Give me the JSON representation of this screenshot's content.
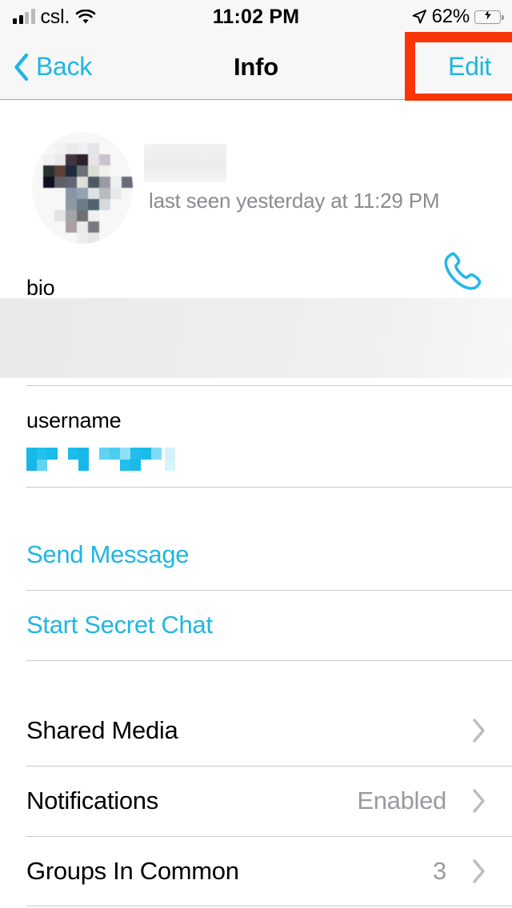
{
  "status_bar": {
    "carrier": "csl.",
    "time": "11:02 PM",
    "battery_percent": "62%",
    "battery_level": 62,
    "charging": true,
    "icons": [
      "signal-bars-icon",
      "wifi-icon",
      "location-arrow-icon",
      "battery-charging-icon"
    ]
  },
  "nav_bar": {
    "back_label": "Back",
    "title": "Info",
    "edit_label": "Edit",
    "highlight_color": "#fa3508",
    "accent_color": "#1fb6e3"
  },
  "profile": {
    "name": "",
    "name_redacted": true,
    "status": "last seen yesterday at 11:29 PM",
    "call_icon": "phone-icon",
    "avatar_redacted": true
  },
  "fields": [
    {
      "label": "bio",
      "value": "",
      "redacted": true
    },
    {
      "label": "username",
      "value": "",
      "redacted": true
    }
  ],
  "actions": [
    {
      "label": "Send Message",
      "name": "send-message-button"
    },
    {
      "label": "Start Secret Chat",
      "name": "start-secret-chat-button"
    }
  ],
  "menu_rows": [
    {
      "label": "Shared Media",
      "value": "",
      "chevron": true
    },
    {
      "label": "Notifications",
      "value": "Enabled",
      "chevron": true
    },
    {
      "label": "Groups In Common",
      "value": "3",
      "chevron": true
    }
  ]
}
